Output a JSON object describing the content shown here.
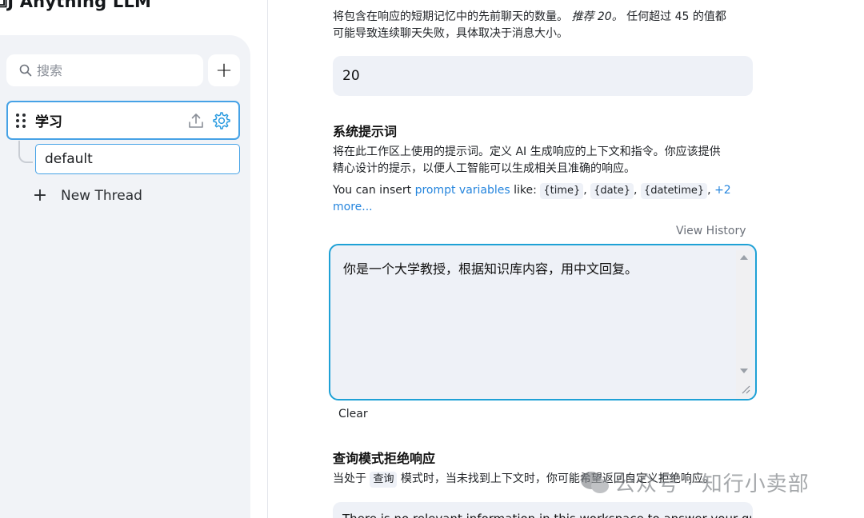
{
  "app": {
    "brand": "Anything LLM"
  },
  "sidebar": {
    "search_placeholder": "搜索",
    "workspace": {
      "name": "学习"
    },
    "threads": [
      {
        "label": "default"
      }
    ],
    "new_thread_label": "New Thread"
  },
  "settings": {
    "history": {
      "description_1": "将包含在响应的短期记忆中的先前聊天的数量。",
      "recommend": "推荐 20。",
      "description_2": "任何超过 45 的值都",
      "description_3": "可能导致连续聊天失败，具体取决于消息大小。",
      "value": "20"
    },
    "system_prompt": {
      "title": "系统提示词",
      "description_1": "将在此工作区上使用的提示词。定义 AI 生成响应的上下文和指令。你应该提供",
      "description_2": "精心设计的提示，以便人工智能可以生成相关且准确的响应。",
      "vars_prefix": "You can insert",
      "vars_link": "prompt variables",
      "vars_like": "like:",
      "var_1": "{time}",
      "var_2": "{date}",
      "var_3": "{datetime}",
      "more_link": "+2 more...",
      "view_history": "View History",
      "value": "你是一个大学教授，根据知识库内容，用中文回复。",
      "clear_label": "Clear"
    },
    "query_refusal": {
      "title": "查询模式拒绝响应",
      "desc_before": "当处于",
      "mode_chip": "查询",
      "desc_after": "模式时，当未找到上下文时，你可能希望返回自定义拒绝响应。",
      "value": "There is no relevant information in this workspace to answer your query."
    }
  },
  "watermark": {
    "text": "公众号 · 知行小卖部"
  }
}
